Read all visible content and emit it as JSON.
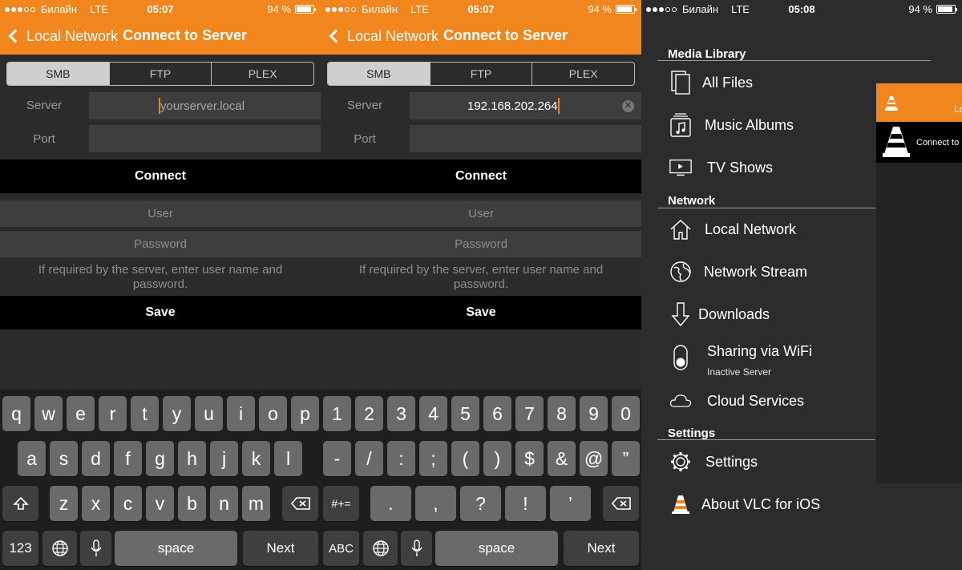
{
  "status_left": {
    "carrier": "Билайн",
    "network": "LTE",
    "time": "05:07",
    "battery": "94 %"
  },
  "status_right": {
    "carrier": "Билайн",
    "network": "LTE",
    "time": "05:08",
    "battery": "94 %"
  },
  "connect_nav": {
    "back_label": "Local Network",
    "title": "Connect to Server"
  },
  "segments": [
    "SMB",
    "FTP",
    "PLEX"
  ],
  "form": {
    "server_label": "Server",
    "port_label": "Port",
    "server_placeholder": "yourserver.local",
    "server_value": "192.168.202.264",
    "connect_label": "Connect",
    "user_placeholder": "User",
    "password_placeholder": "Password",
    "hint": "If required by the server, enter user name and password.",
    "save_label": "Save"
  },
  "keyboard_letters": {
    "row1": [
      "q",
      "w",
      "e",
      "r",
      "t",
      "y",
      "u",
      "i",
      "o",
      "p"
    ],
    "row2": [
      "a",
      "s",
      "d",
      "f",
      "g",
      "h",
      "j",
      "k",
      "l"
    ],
    "row3": [
      "z",
      "x",
      "c",
      "v",
      "b",
      "n",
      "m"
    ],
    "mode_key": "123",
    "space": "space",
    "return": "Next"
  },
  "keyboard_numbers": {
    "row1": [
      "1",
      "2",
      "3",
      "4",
      "5",
      "6",
      "7",
      "8",
      "9",
      "0"
    ],
    "row2": [
      "-",
      "/",
      ":",
      ";",
      "(",
      ")",
      "$",
      "&",
      "@",
      "”"
    ],
    "row3": [
      ".",
      ",",
      "?",
      "!",
      "’"
    ],
    "symbols_key": "#+=",
    "mode_key": "ABC",
    "space": "space",
    "return": "Next"
  },
  "menu": {
    "media_library": "Media Library",
    "all_files": "All Files",
    "music_albums": "Music Albums",
    "tv_shows": "TV Shows",
    "network": "Network",
    "local_network": "Local Network",
    "network_stream": "Network Stream",
    "downloads": "Downloads",
    "sharing": "Sharing via WiFi",
    "sharing_status": "Inactive Server",
    "cloud": "Cloud Services",
    "settings_head": "Settings",
    "settings": "Settings",
    "about": "About VLC for iOS"
  },
  "peek": {
    "header_fragment": "Lo",
    "row_fragment": "Connect to"
  },
  "colors": {
    "accent": "#f0861d",
    "background": "#2b2b2b"
  }
}
